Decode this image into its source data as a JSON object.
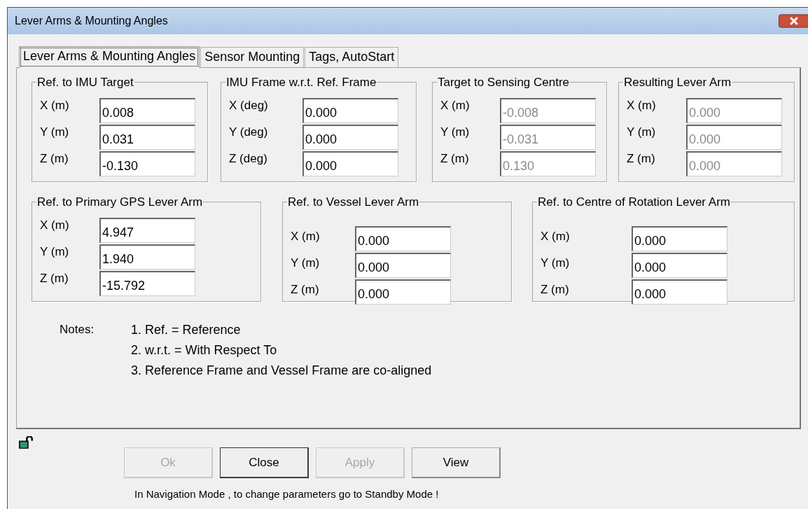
{
  "window": {
    "title": "Lever Arms & Mounting Angles"
  },
  "tabs": [
    {
      "label": "Lever Arms & Mounting Angles",
      "selected": true
    },
    {
      "label": "Sensor Mounting",
      "selected": false
    },
    {
      "label": "Tags, AutoStart",
      "selected": false
    }
  ],
  "groups": [
    {
      "title": "Ref. to IMU Target",
      "fields": [
        {
          "label": "X (m)",
          "value": "0.008",
          "disabled": false
        },
        {
          "label": "Y (m)",
          "value": "0.031",
          "disabled": false
        },
        {
          "label": "Z (m)",
          "value": "-0.130",
          "disabled": false
        }
      ]
    },
    {
      "title": "IMU Frame w.r.t. Ref. Frame",
      "fields": [
        {
          "label": "X (deg)",
          "value": "0.000",
          "disabled": false
        },
        {
          "label": "Y (deg)",
          "value": "0.000",
          "disabled": false
        },
        {
          "label": "Z (deg)",
          "value": "0.000",
          "disabled": false
        }
      ]
    },
    {
      "title": "Target to Sensing Centre",
      "fields": [
        {
          "label": "X (m)",
          "value": "-0.008",
          "disabled": true
        },
        {
          "label": "Y (m)",
          "value": "-0.031",
          "disabled": true
        },
        {
          "label": "Z (m)",
          "value": "0.130",
          "disabled": true
        }
      ]
    },
    {
      "title": "Resulting Lever Arm",
      "fields": [
        {
          "label": "X (m)",
          "value": "0.000",
          "disabled": true
        },
        {
          "label": "Y (m)",
          "value": "0.000",
          "disabled": true
        },
        {
          "label": "Z (m)",
          "value": "0.000",
          "disabled": true
        }
      ]
    },
    {
      "title": "Ref. to Primary GPS Lever Arm",
      "fields": [
        {
          "label": "X (m)",
          "value": "4.947",
          "disabled": false
        },
        {
          "label": "Y (m)",
          "value": "1.940",
          "disabled": false
        },
        {
          "label": "Z (m)",
          "value": "-15.792",
          "disabled": false
        }
      ]
    },
    {
      "title": "Ref. to Vessel Lever Arm",
      "fields": [
        {
          "label": "X (m)",
          "value": "0.000",
          "disabled": false
        },
        {
          "label": "Y (m)",
          "value": "0.000",
          "disabled": false
        },
        {
          "label": "Z (m)",
          "value": "0.000",
          "disabled": false
        }
      ]
    },
    {
      "title": "Ref. to Centre of Rotation Lever Arm",
      "fields": [
        {
          "label": "X (m)",
          "value": "0.000",
          "disabled": false
        },
        {
          "label": "Y (m)",
          "value": "0.000",
          "disabled": false
        },
        {
          "label": "Z (m)",
          "value": "0.000",
          "disabled": false
        }
      ]
    }
  ],
  "notes": {
    "label": "Notes:",
    "items": [
      "1. Ref. = Reference",
      "2. w.r.t. = With Respect To",
      "3. Reference Frame and Vessel Frame are co-aligned"
    ]
  },
  "buttons": [
    {
      "label": "Ok",
      "disabled": true,
      "default": false
    },
    {
      "label": "Close",
      "disabled": false,
      "default": true
    },
    {
      "label": "Apply",
      "disabled": true,
      "default": false
    },
    {
      "label": "View",
      "disabled": false,
      "default": false
    }
  ],
  "message": "In Navigation Mode , to change parameters go to Standby Mode !"
}
